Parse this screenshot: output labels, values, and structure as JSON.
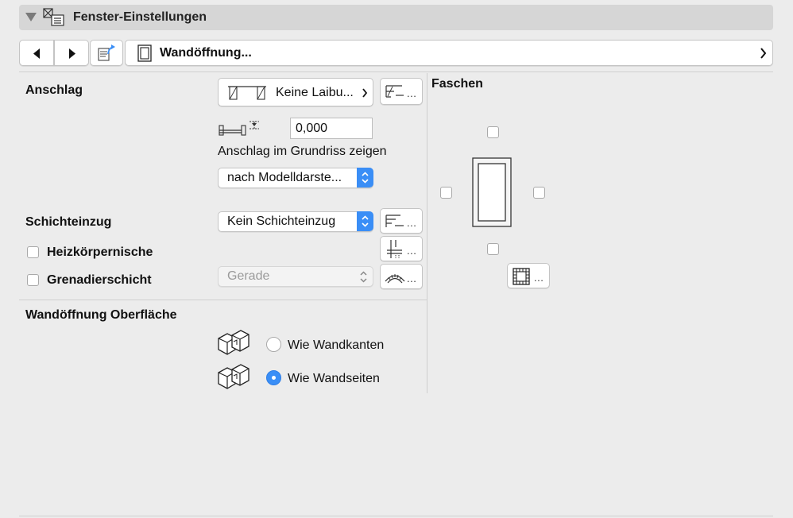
{
  "header": {
    "title": "Fenster-Einstellungen",
    "icon": "window-settings-icon"
  },
  "navbar": {
    "title": "Wandöffnung...",
    "icons": [
      "chevron-left-icon",
      "chevron-right-icon",
      "favorites-icon",
      "window-frame-icon",
      "chevron-right-icon"
    ]
  },
  "anschlag": {
    "label": "Anschlag",
    "button_label": "Keine Laibu...",
    "value": "0,000",
    "show_label": "Anschlag im Grundriss zeigen",
    "display_select": "nach Modelldarste...",
    "more": "..."
  },
  "schichteinzug": {
    "label": "Schichteinzug",
    "select": "Kein Schichteinzug",
    "more": "..."
  },
  "heizkoerper": {
    "label": "Heizkörpernische",
    "checked": false,
    "more": "..."
  },
  "grenadier": {
    "label": "Grenadierschicht",
    "checked": false,
    "select": "Gerade",
    "more": "..."
  },
  "oberflaeche": {
    "label": "Wandöffnung Oberfläche",
    "options": [
      {
        "label": "Wie Wandkanten",
        "selected": false
      },
      {
        "label": "Wie Wandseiten",
        "selected": true
      }
    ]
  },
  "faschen": {
    "label": "Faschen",
    "more": "..."
  },
  "colors": {
    "accent": "#3a8ef6",
    "header_bg": "#d6d6d6",
    "panel_bg": "#ececec"
  }
}
